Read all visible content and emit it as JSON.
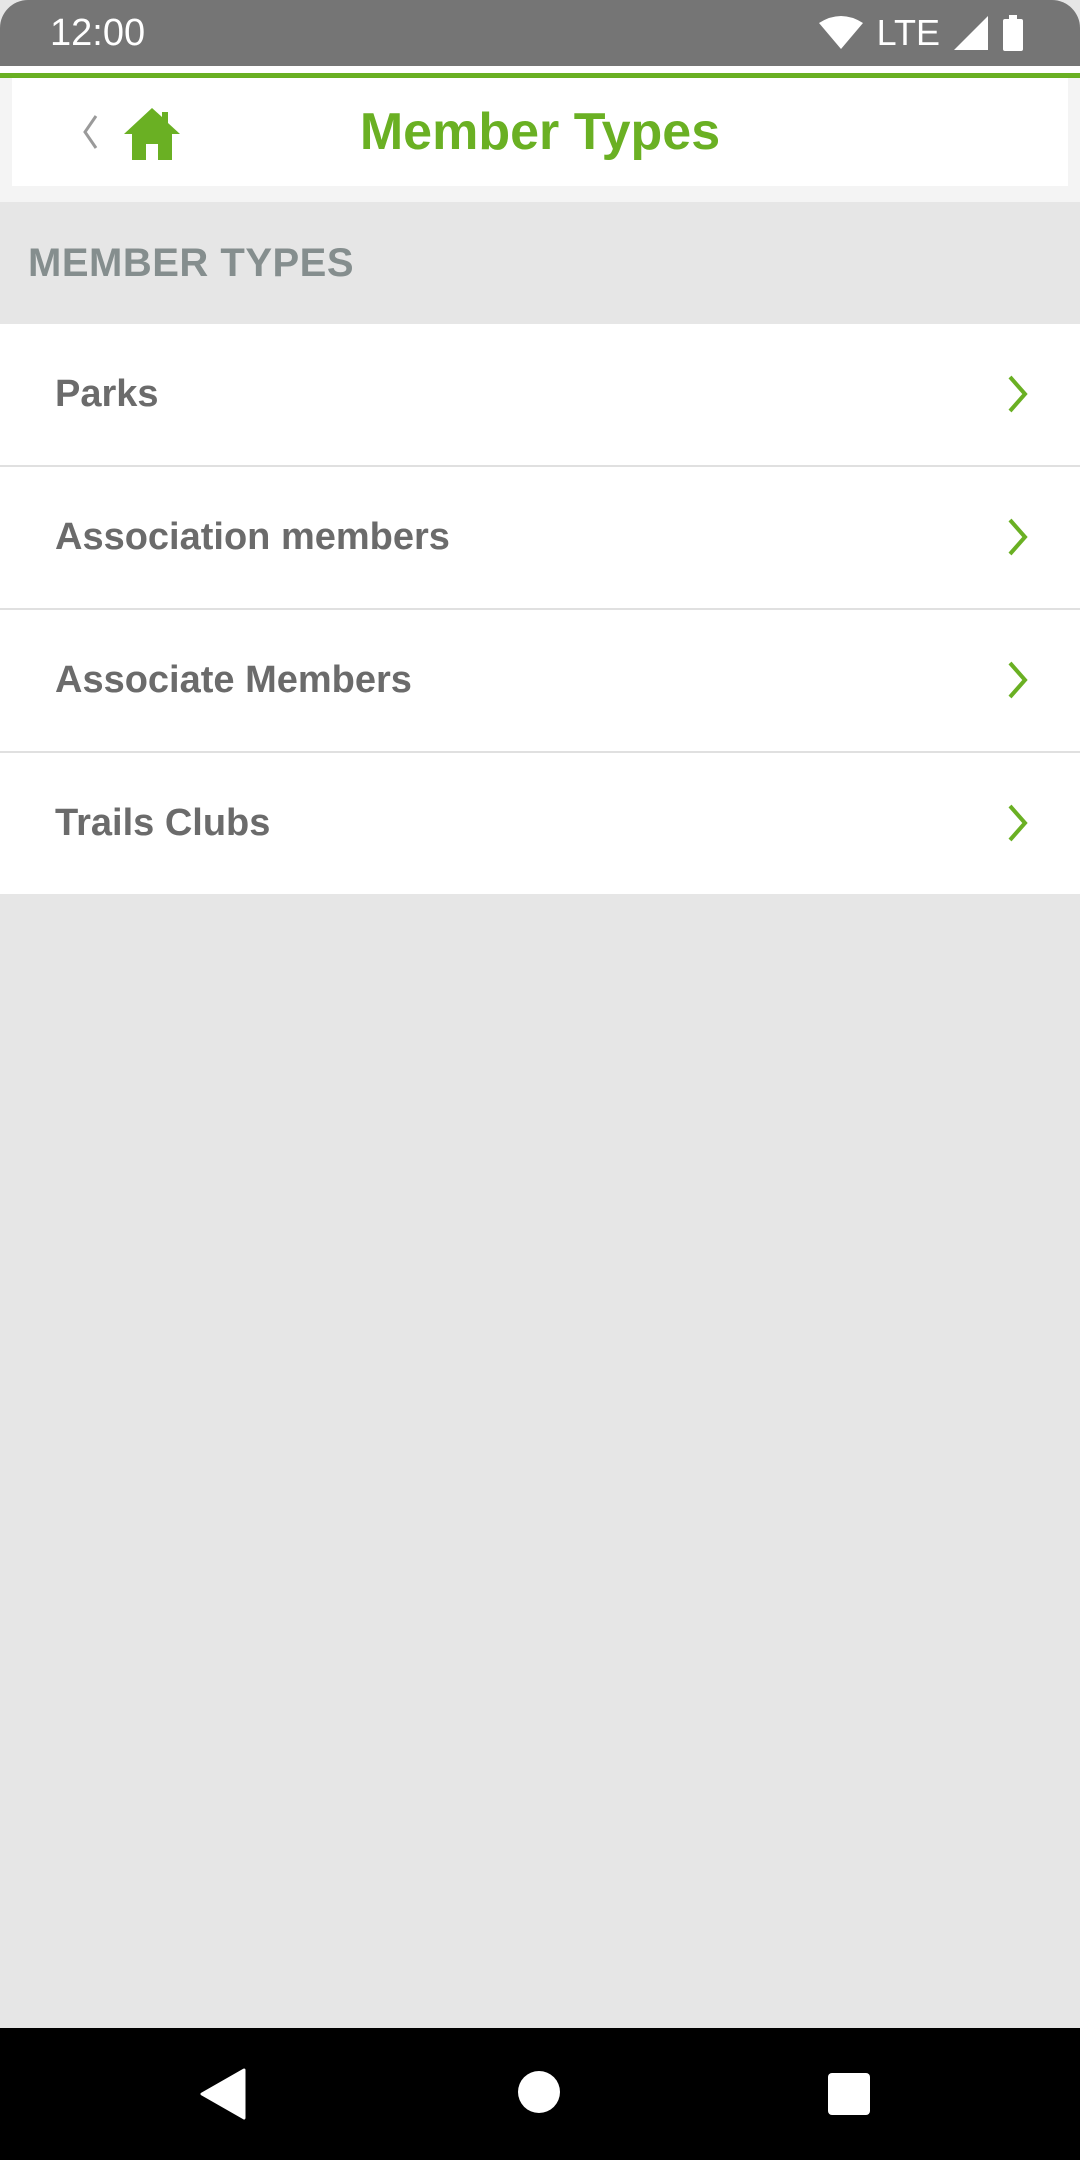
{
  "status_bar": {
    "time": "12:00",
    "network": "LTE",
    "icons": [
      "wifi-icon",
      "signal-icon",
      "battery-icon"
    ]
  },
  "header": {
    "title": "Member Types",
    "back_icon": "chevron-left-icon",
    "home_icon": "home-icon"
  },
  "section": {
    "title": "MEMBER TYPES"
  },
  "list": {
    "items": [
      {
        "label": "Parks"
      },
      {
        "label": "Association members"
      },
      {
        "label": "Associate Members"
      },
      {
        "label": "Trails Clubs"
      }
    ]
  },
  "nav_bar": {
    "icons": [
      "nav-back-icon",
      "nav-home-icon",
      "nav-recents-icon"
    ]
  },
  "colors": {
    "accent": "#6ab023",
    "status_bar": "#757575",
    "background": "#e6e6e6",
    "section_text": "#858e8e",
    "item_text": "#6b6b6b"
  }
}
